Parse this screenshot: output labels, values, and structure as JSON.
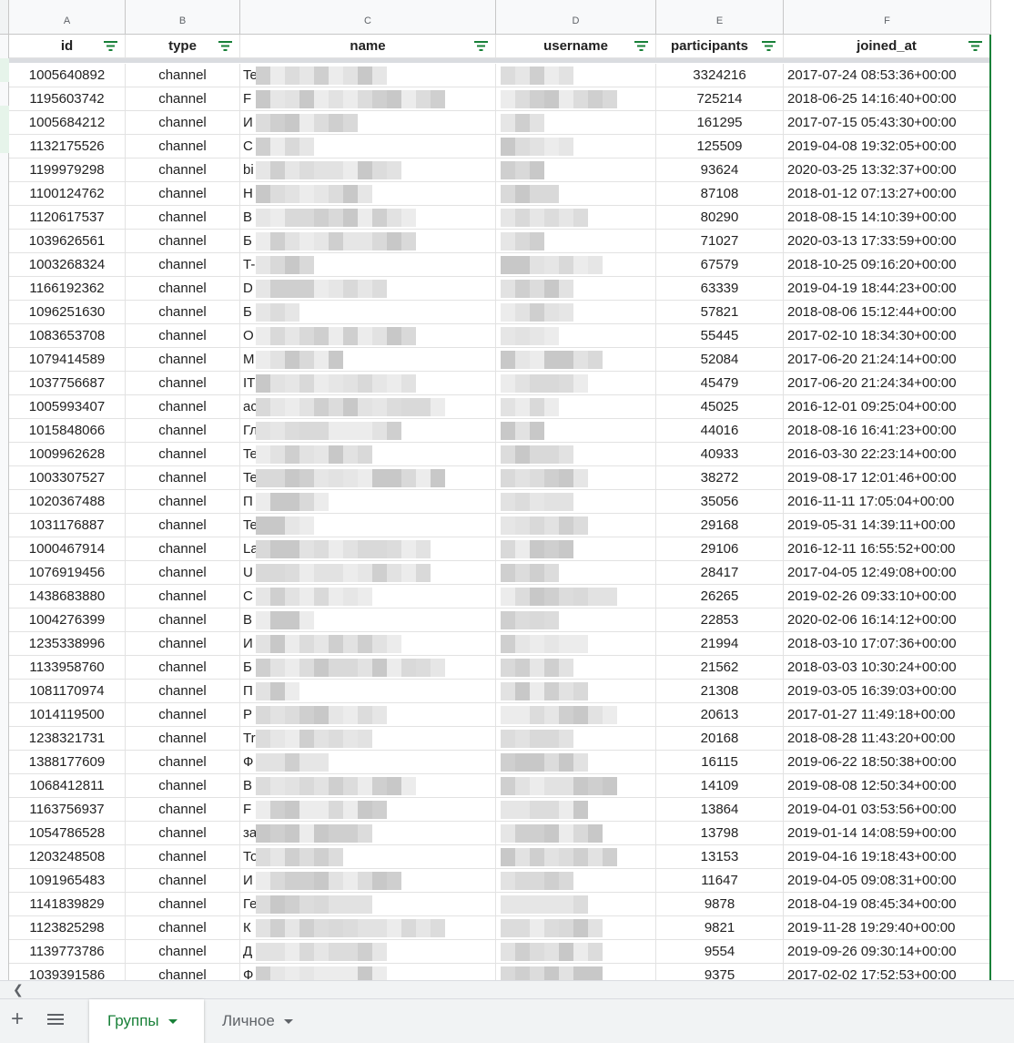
{
  "columns": {
    "letters": [
      "A",
      "B",
      "C",
      "D",
      "E",
      "F"
    ],
    "headers": [
      "id",
      "type",
      "name",
      "username",
      "participants",
      "joined_at"
    ]
  },
  "colors": {
    "accent": "#188038",
    "grid": "#e2e2e2",
    "header_bg": "#f8f9fa"
  },
  "icons": {
    "filter": "filter-icon",
    "add": "plus-icon",
    "menu": "list-icon",
    "scroll_left": "chevron-left-icon"
  },
  "rows": [
    {
      "id": "1005640892",
      "type": "channel",
      "name": "Te",
      "participants": "3324216",
      "joined_at": "2017-07-24 08:53:36+00:00"
    },
    {
      "id": "1195603742",
      "type": "channel",
      "name": "F",
      "participants": "725214",
      "joined_at": "2018-06-25 14:16:40+00:00"
    },
    {
      "id": "1005684212",
      "type": "channel",
      "name": "И",
      "participants": "161295",
      "joined_at": "2017-07-15 05:43:30+00:00"
    },
    {
      "id": "1132175526",
      "type": "channel",
      "name": "С",
      "participants": "125509",
      "joined_at": "2019-04-08 19:32:05+00:00"
    },
    {
      "id": "1199979298",
      "type": "channel",
      "name": "bi",
      "participants": "93624",
      "joined_at": "2020-03-25 13:32:37+00:00"
    },
    {
      "id": "1100124762",
      "type": "channel",
      "name": "Н",
      "participants": "87108",
      "joined_at": "2018-01-12 07:13:27+00:00"
    },
    {
      "id": "1120617537",
      "type": "channel",
      "name": "В",
      "participants": "80290",
      "joined_at": "2018-08-15 14:10:39+00:00"
    },
    {
      "id": "1039626561",
      "type": "channel",
      "name": "Б",
      "participants": "71027",
      "joined_at": "2020-03-13 17:33:59+00:00"
    },
    {
      "id": "1003268324",
      "type": "channel",
      "name": "T-",
      "participants": "67579",
      "joined_at": "2018-10-25 09:16:20+00:00"
    },
    {
      "id": "1166192362",
      "type": "channel",
      "name": "D",
      "participants": "63339",
      "joined_at": "2019-04-19 18:44:23+00:00"
    },
    {
      "id": "1096251630",
      "type": "channel",
      "name": "Б",
      "participants": "57821",
      "joined_at": "2018-08-06 15:12:44+00:00"
    },
    {
      "id": "1083653708",
      "type": "channel",
      "name": "О",
      "participants": "55445",
      "joined_at": "2017-02-10 18:34:30+00:00"
    },
    {
      "id": "1079414589",
      "type": "channel",
      "name": "М",
      "participants": "52084",
      "joined_at": "2017-06-20 21:24:14+00:00"
    },
    {
      "id": "1037756687",
      "type": "channel",
      "name": "IT",
      "participants": "45479",
      "joined_at": "2017-06-20 21:24:34+00:00"
    },
    {
      "id": "1005993407",
      "type": "channel",
      "name": "ac",
      "participants": "45025",
      "joined_at": "2016-12-01 09:25:04+00:00"
    },
    {
      "id": "1015848066",
      "type": "channel",
      "name": "Гл",
      "participants": "44016",
      "joined_at": "2018-08-16 16:41:23+00:00"
    },
    {
      "id": "1009962628",
      "type": "channel",
      "name": "Te",
      "participants": "40933",
      "joined_at": "2016-03-30 22:23:14+00:00"
    },
    {
      "id": "1003307527",
      "type": "channel",
      "name": "Te",
      "participants": "38272",
      "joined_at": "2019-08-17 12:01:46+00:00"
    },
    {
      "id": "1020367488",
      "type": "channel",
      "name": "П",
      "participants": "35056",
      "joined_at": "2016-11-11 17:05:04+00:00"
    },
    {
      "id": "1031176887",
      "type": "channel",
      "name": "Te",
      "participants": "29168",
      "joined_at": "2019-05-31 14:39:11+00:00"
    },
    {
      "id": "1000467914",
      "type": "channel",
      "name": "La",
      "participants": "29106",
      "joined_at": "2016-12-11 16:55:52+00:00"
    },
    {
      "id": "1076919456",
      "type": "channel",
      "name": "U",
      "participants": "28417",
      "joined_at": "2017-04-05 12:49:08+00:00"
    },
    {
      "id": "1438683880",
      "type": "channel",
      "name": "С",
      "participants": "26265",
      "joined_at": "2019-02-26 09:33:10+00:00"
    },
    {
      "id": "1004276399",
      "type": "channel",
      "name": "В",
      "participants": "22853",
      "joined_at": "2020-02-06 16:14:12+00:00"
    },
    {
      "id": "1235338996",
      "type": "channel",
      "name": "И",
      "participants": "21994",
      "joined_at": "2018-03-10 17:07:36+00:00"
    },
    {
      "id": "1133958760",
      "type": "channel",
      "name": "Б",
      "participants": "21562",
      "joined_at": "2018-03-03 10:30:24+00:00"
    },
    {
      "id": "1081170974",
      "type": "channel",
      "name": "П",
      "participants": "21308",
      "joined_at": "2019-03-05 16:39:03+00:00"
    },
    {
      "id": "1014119500",
      "type": "channel",
      "name": "Р",
      "participants": "20613",
      "joined_at": "2017-01-27 11:49:18+00:00"
    },
    {
      "id": "1238321731",
      "type": "channel",
      "name": "Tr",
      "participants": "20168",
      "joined_at": "2018-08-28 11:43:20+00:00"
    },
    {
      "id": "1388177609",
      "type": "channel",
      "name": "Ф",
      "participants": "16115",
      "joined_at": "2019-06-22 18:50:38+00:00"
    },
    {
      "id": "1068412811",
      "type": "channel",
      "name": "В",
      "participants": "14109",
      "joined_at": "2019-08-08 12:50:34+00:00"
    },
    {
      "id": "1163756937",
      "type": "channel",
      "name": "F",
      "participants": "13864",
      "joined_at": "2019-04-01 03:53:56+00:00"
    },
    {
      "id": "1054786528",
      "type": "channel",
      "name": "за",
      "participants": "13798",
      "joined_at": "2019-01-14 14:08:59+00:00"
    },
    {
      "id": "1203248508",
      "type": "channel",
      "name": "То",
      "participants": "13153",
      "joined_at": "2019-04-16 19:18:43+00:00"
    },
    {
      "id": "1091965483",
      "type": "channel",
      "name": "И",
      "participants": "11647",
      "joined_at": "2019-04-05 09:08:31+00:00"
    },
    {
      "id": "1141839829",
      "type": "channel",
      "name": "Ге",
      "participants": "9878",
      "joined_at": "2018-04-19 08:45:34+00:00"
    },
    {
      "id": "1123825298",
      "type": "channel",
      "name": "К",
      "participants": "9821",
      "joined_at": "2019-11-28 19:29:40+00:00"
    },
    {
      "id": "1139773786",
      "type": "channel",
      "name": "Д",
      "participants": "9554",
      "joined_at": "2019-09-26 09:30:14+00:00"
    },
    {
      "id": "1039391586",
      "type": "channel",
      "name": "Ф",
      "participants": "9375",
      "joined_at": "2017-02-02 17:52:53+00:00"
    }
  ],
  "sheets": [
    {
      "label": "Группы",
      "active": true
    },
    {
      "label": "Личное",
      "active": false
    }
  ]
}
